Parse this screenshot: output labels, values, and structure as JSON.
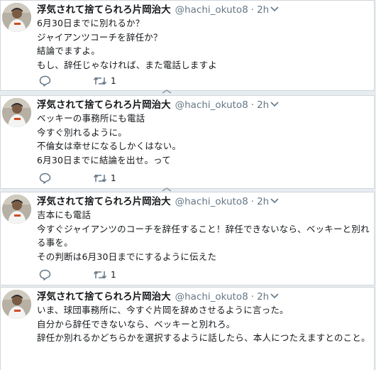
{
  "tweets": [
    {
      "name": "浮気されて捨てられろ片岡治大",
      "handle": "@hachi_okuto8",
      "dot": "·",
      "time": "2h",
      "body": "6月30日までに別れるか？\nジャイアンツコーチを辞任か？\n結論でますよ。\nもし、辞任じゃなければ、また電話しますよ",
      "retweets": "1"
    },
    {
      "name": "浮気されて捨てられろ片岡治大",
      "handle": "@hachi_okuto8",
      "dot": "·",
      "time": "2h",
      "body": "ベッキーの事務所にも電話\n今すぐ別れるように。\n不倫女は幸せになるしかくはない。\n6月30日までに結論を出せ。って",
      "retweets": "1"
    },
    {
      "name": "浮気されて捨てられろ片岡治大",
      "handle": "@hachi_okuto8",
      "dot": "·",
      "time": "2h",
      "body": "吉本にも電話\n今すぐジャイアンツのコーチを辞任すること！辞任できないなら、ベッキーと別れる事を。\nその判断は6月30日までにするように伝えた",
      "retweets": "1"
    },
    {
      "name": "浮気されて捨てられろ片岡治大",
      "handle": "@hachi_okuto8",
      "dot": "·",
      "time": "2h",
      "body": "いま、球団事務所に、今すぐ片岡を辞めさせるように言った。\n自分から辞任できないなら、ベッキーと別れろ。\n辞任か別れるかどちらかを選択するように話したら、本人につたえますとのこと。"
    }
  ],
  "colors": {
    "background": "#e6ecf0",
    "card": "#ffffff",
    "text": "#14171a",
    "muted": "#657786",
    "icon": "#657786"
  }
}
